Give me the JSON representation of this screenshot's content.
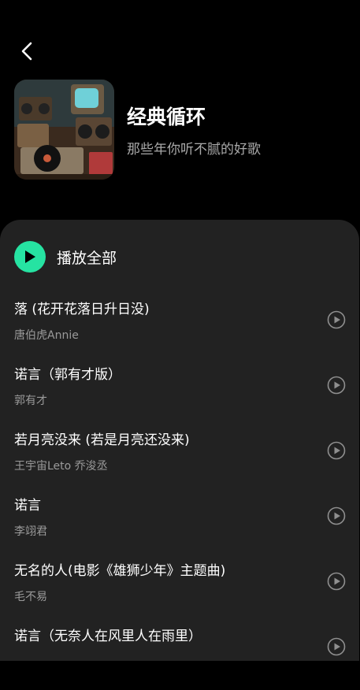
{
  "header": {
    "back_icon": "chevron-left-icon",
    "title": "经典循环",
    "subtitle": "那些年你听不腻的好歌"
  },
  "play_all": {
    "label": "播放全部",
    "icon": "play-icon",
    "accent_color": "#26e3a2"
  },
  "songs": [
    {
      "title": "落 (花开花落日升日没)",
      "artist": "唐伯虎Annie"
    },
    {
      "title": "诺言（郭有才版）",
      "artist": "郭有才"
    },
    {
      "title": "若月亮没来 (若是月亮还没来)",
      "artist": "王宇宙Leto 乔浚丞"
    },
    {
      "title": "诺言",
      "artist": "李翊君"
    },
    {
      "title": "无名的人(电影《雄狮少年》主题曲)",
      "artist": "毛不易"
    },
    {
      "title": "诺言（无奈人在风里人在雨里）",
      "artist": ""
    }
  ]
}
